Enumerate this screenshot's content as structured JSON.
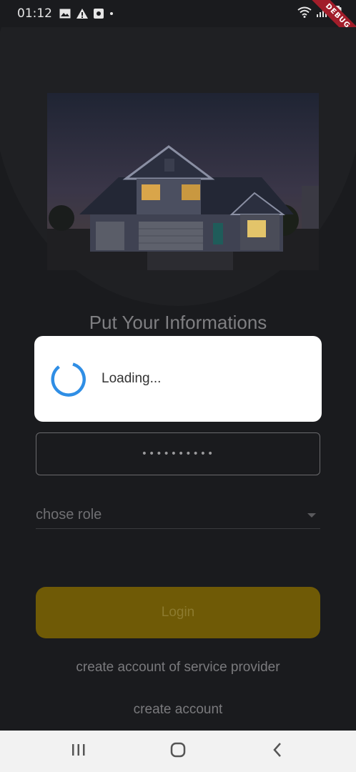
{
  "status_bar": {
    "time": "01:12",
    "icons": [
      "gallery-icon",
      "warning-icon",
      "record-icon",
      "dot-icon"
    ],
    "right_icons": [
      "wifi-icon",
      "signal-icon",
      "battery-icon"
    ]
  },
  "debug_banner": "DEBUG",
  "form": {
    "heading": "Put Your Informations",
    "password_value": "••••••••••",
    "role_placeholder": "chose role",
    "login_label": "Login",
    "link_service_provider": "create account of service provider",
    "link_create_account": "create account"
  },
  "loading_dialog": {
    "text": "Loading...",
    "spinner_color": "#2f8ee5"
  },
  "colors": {
    "background": "#1a1b1e",
    "login_button": "#6f5a06"
  },
  "nav_bar": {
    "buttons": [
      "recents-icon",
      "home-icon",
      "back-icon"
    ]
  }
}
